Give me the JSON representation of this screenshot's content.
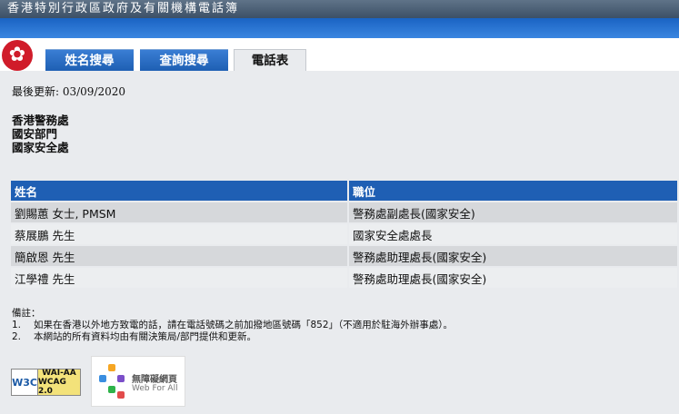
{
  "header": {
    "site_title": "香港特別行政區政府及有關機構電話簿"
  },
  "tabs": [
    {
      "label": "姓名搜尋",
      "active": false
    },
    {
      "label": "查詢搜尋",
      "active": false
    },
    {
      "label": "電話表",
      "active": true
    }
  ],
  "last_updated": "最後更新: 03/09/2020",
  "departments": [
    "香港警務處",
    "國安部門",
    "國家安全處"
  ],
  "table": {
    "headers": [
      "姓名",
      "職位"
    ],
    "rows": [
      {
        "name": "劉賜蕙 女士, PMSM",
        "post": "警務處副處長(國家安全)"
      },
      {
        "name": "蔡展鵬 先生",
        "post": "國家安全處處長"
      },
      {
        "name": "簡啟恩 先生",
        "post": "警務處助理處長(國家安全)"
      },
      {
        "name": "江學禮 先生",
        "post": "警務處助理處長(國家安全)"
      }
    ]
  },
  "notes": {
    "title": "備註：",
    "items": [
      {
        "num": "1.",
        "text": "如果在香港以外地方致電的話，請在電話號碼之前加撥地區號碼「852」（不適用於駐海外辦事處）。"
      },
      {
        "num": "2.",
        "text": "本網站的所有資料均由有關決策局/部門提供和更新。"
      }
    ]
  },
  "badges": {
    "w3c": "W3C",
    "wai_line1": "WAI-AA",
    "wai_line2": "WCAG 2.0",
    "wfa_line1": "無障礙網頁",
    "wfa_line2": "Web For All"
  },
  "colors": {
    "header_gray": "#4a5e74",
    "tab_blue": "#1f5fb4",
    "table_header": "#1f5fb4",
    "row_odd": "#d6d8db",
    "row_even": "#eceef0",
    "emblem_red": "#d01c2a"
  }
}
